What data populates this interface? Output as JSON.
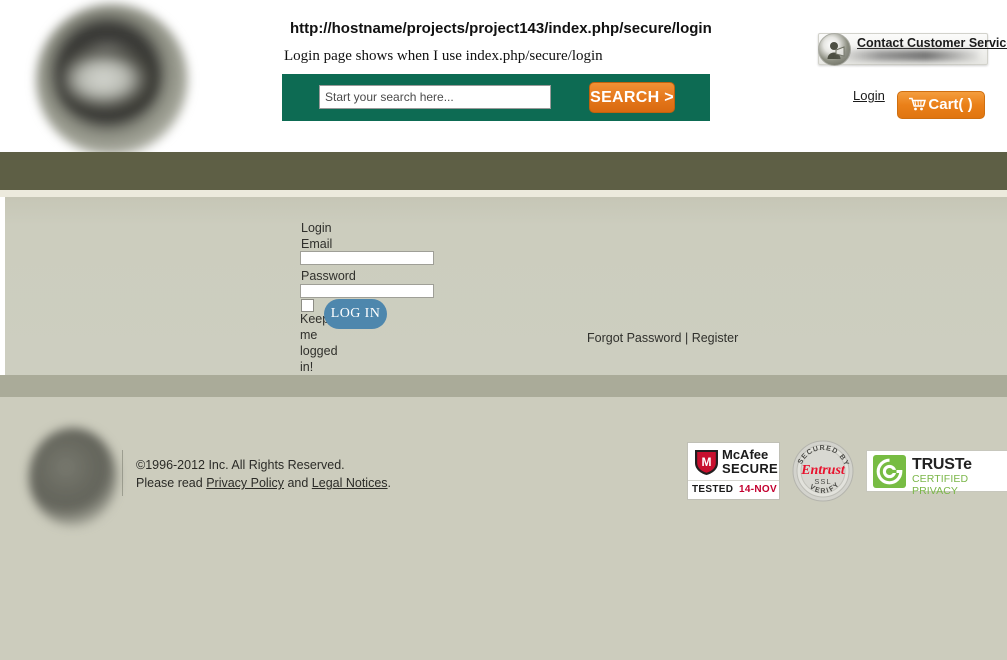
{
  "header": {
    "page_url": "http://hostname/projects/project143/index.php/secure/login",
    "page_note": "Login page shows when I use index.php/secure/login",
    "brand_logo_name": "blurred-circular-brand-logo",
    "search": {
      "placeholder": "Start your search here...",
      "value": "",
      "button_label": "SEARCH >",
      "band_color": "#0d6b53",
      "button_color": "#e4761a"
    },
    "contact_customer_service": {
      "label": "Contact Customer Service",
      "icon": "person-headset-icon"
    },
    "login_link": "Login",
    "cart": {
      "label": "Cart(    )",
      "icon": "shopping-cart-icon",
      "color": "#ea8019"
    }
  },
  "nav": {
    "bar_color": "#5e5f45",
    "divider_color": "#eceadd"
  },
  "main": {
    "background_color": "#cdcec0",
    "form": {
      "heading": "Login",
      "email_label": "Email",
      "email_value": "",
      "password_label": "Password",
      "password_value": "",
      "keep_logged_in_label": "Keep me logged in!",
      "keep_logged_in_checked": false,
      "submit_label": "LOG IN",
      "submit_color": "#4e87ad"
    },
    "aux_links": {
      "forgot_password": "Forgot Password",
      "separator": " | ",
      "register": "Register"
    }
  },
  "footer": {
    "band_color": "#aaab99",
    "background_color": "#ccccbd",
    "logo_name": "blurred-circular-footer-logo",
    "copyright": "©1996-2012 Inc. All Rights Reserved.",
    "legal_prefix": "Please read ",
    "privacy_policy": "Privacy Policy",
    "legal_conjunction": " and ",
    "legal_notices": "Legal Notices",
    "legal_suffix": ".",
    "badges": {
      "mcafee": {
        "word1": "McAfee",
        "word2": "SECURE",
        "tested": "TESTED",
        "date": "14-NOV"
      },
      "entrust": {
        "top_arc": "SECURED BY",
        "brand": "Entrust",
        "ssl": "SSL",
        "bottom_arc": "VERIFY"
      },
      "truste": {
        "title": "TRUSTe",
        "subtitle": "CERTIFIED PRIVACY",
        "mark_color": "#77bc43"
      }
    }
  }
}
